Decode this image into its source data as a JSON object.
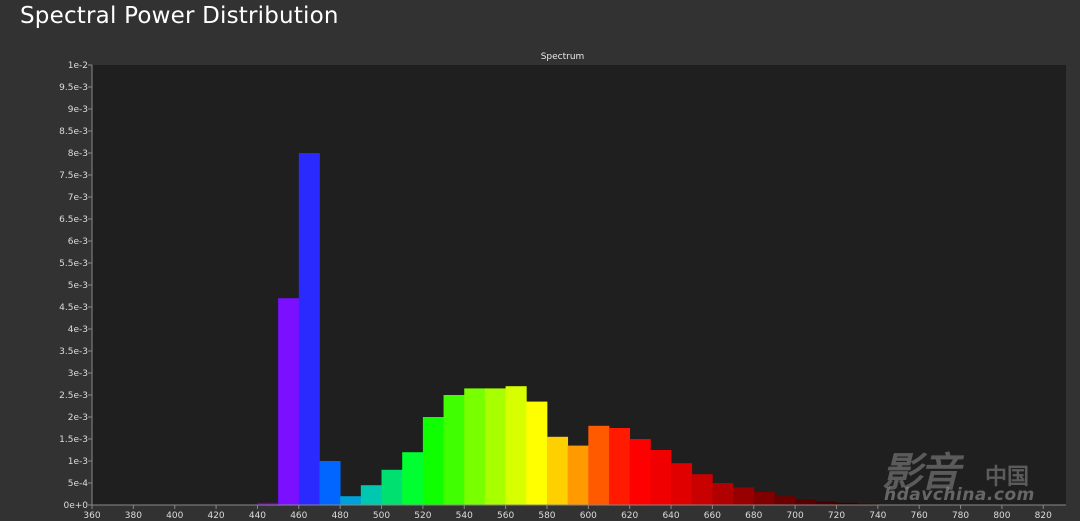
{
  "page": {
    "title": "Spectral Power Distribution"
  },
  "watermark": {
    "glyphs": "影音",
    "cn": "中国",
    "url": "hdavchina.com"
  },
  "colors": {
    "background": "#323232",
    "plot_area": "#1f1f1f",
    "axis": "#888888"
  },
  "chart_data": {
    "type": "bar",
    "title": "Spectrum",
    "xlabel": "",
    "ylabel": "",
    "xlim": [
      360,
      830
    ],
    "ylim": [
      0,
      0.01
    ],
    "x_ticks": [
      360,
      380,
      400,
      420,
      440,
      460,
      480,
      500,
      520,
      540,
      560,
      580,
      600,
      620,
      640,
      660,
      680,
      700,
      720,
      740,
      760,
      780,
      800,
      820
    ],
    "x_tick_labels": [
      "360",
      "380",
      "400",
      "420",
      "440",
      "460",
      "480",
      "500",
      "520",
      "540",
      "560",
      "580",
      "600",
      "620",
      "640",
      "660",
      "680",
      "700",
      "720",
      "740",
      "760",
      "780",
      "800",
      "820"
    ],
    "y_ticks": [
      0,
      0.0005,
      0.001,
      0.0015,
      0.002,
      0.0025,
      0.003,
      0.0035,
      0.004,
      0.0045,
      0.005,
      0.0055,
      0.006,
      0.0065,
      0.007,
      0.0075,
      0.008,
      0.0085,
      0.009,
      0.0095,
      0.01
    ],
    "y_tick_labels": [
      "0e+0",
      "5e-4",
      "1e-3",
      "1.5e-3",
      "2e-3",
      "2.5e-3",
      "3e-3",
      "3.5e-3",
      "4e-3",
      "4.5e-3",
      "5e-3",
      "5.5e-3",
      "6e-3",
      "6.5e-3",
      "7e-3",
      "7.5e-3",
      "8e-3",
      "8.5e-3",
      "9e-3",
      "9.5e-3",
      "1e-2"
    ],
    "grid": false,
    "bin_width": 10,
    "bins": [
      {
        "x": 440,
        "y": 5e-05,
        "color": "#6a00a8"
      },
      {
        "x": 450,
        "y": 0.0047,
        "color": "#7a10ff"
      },
      {
        "x": 460,
        "y": 0.008,
        "color": "#2a2aff"
      },
      {
        "x": 470,
        "y": 0.001,
        "color": "#0066ff"
      },
      {
        "x": 480,
        "y": 0.0002,
        "color": "#00a0d8"
      },
      {
        "x": 490,
        "y": 0.00045,
        "color": "#00c8b0"
      },
      {
        "x": 500,
        "y": 0.0008,
        "color": "#00e070"
      },
      {
        "x": 510,
        "y": 0.0012,
        "color": "#00ff30"
      },
      {
        "x": 520,
        "y": 0.002,
        "color": "#10ff00"
      },
      {
        "x": 530,
        "y": 0.0025,
        "color": "#40ff00"
      },
      {
        "x": 540,
        "y": 0.00265,
        "color": "#78ff00"
      },
      {
        "x": 550,
        "y": 0.00265,
        "color": "#a8ff00"
      },
      {
        "x": 560,
        "y": 0.0027,
        "color": "#d8ff00"
      },
      {
        "x": 570,
        "y": 0.00235,
        "color": "#ffff00"
      },
      {
        "x": 580,
        "y": 0.00155,
        "color": "#ffd000"
      },
      {
        "x": 590,
        "y": 0.00135,
        "color": "#ff9a00"
      },
      {
        "x": 600,
        "y": 0.0018,
        "color": "#ff5a00"
      },
      {
        "x": 610,
        "y": 0.00175,
        "color": "#ff1a00"
      },
      {
        "x": 620,
        "y": 0.0015,
        "color": "#ff0000"
      },
      {
        "x": 630,
        "y": 0.00125,
        "color": "#f00000"
      },
      {
        "x": 640,
        "y": 0.00095,
        "color": "#e00000"
      },
      {
        "x": 650,
        "y": 0.0007,
        "color": "#c80000"
      },
      {
        "x": 660,
        "y": 0.0005,
        "color": "#b00000"
      },
      {
        "x": 670,
        "y": 0.0004,
        "color": "#980000"
      },
      {
        "x": 680,
        "y": 0.0003,
        "color": "#800000"
      },
      {
        "x": 690,
        "y": 0.0002,
        "color": "#6a0000"
      },
      {
        "x": 700,
        "y": 0.00013,
        "color": "#560000"
      },
      {
        "x": 710,
        "y": 8e-05,
        "color": "#440000"
      },
      {
        "x": 720,
        "y": 5e-05,
        "color": "#360000"
      },
      {
        "x": 730,
        "y": 3e-05,
        "color": "#2c0000"
      }
    ]
  }
}
